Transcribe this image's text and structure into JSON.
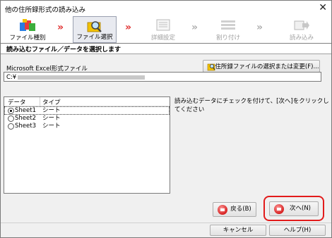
{
  "window": {
    "title": "他の住所録形式の読み込み",
    "close_glyph": "✕"
  },
  "steps": [
    {
      "label": "ファイル種別",
      "state": "done"
    },
    {
      "label": "ファイル選択",
      "state": "active"
    },
    {
      "label": "詳細設定",
      "state": "disabled"
    },
    {
      "label": "割り付け",
      "state": "disabled"
    },
    {
      "label": "読み込み",
      "state": "disabled"
    }
  ],
  "arrows": "»",
  "section_title": "読み込むファイル／データを選択します",
  "file": {
    "type_label": "Microsoft Excel形式ファイル",
    "path_prefix": "C:¥",
    "select_button": "住所録ファイルの選択または変更(F)..."
  },
  "list": {
    "headers": [
      "データ",
      "タイプ"
    ],
    "rows": [
      {
        "name": "Sheet1",
        "type": "シート",
        "selected": true
      },
      {
        "name": "Sheet2",
        "type": "シート",
        "selected": false
      },
      {
        "name": "Sheet3",
        "type": "シート",
        "selected": false
      }
    ]
  },
  "instruction": "読み込むデータにチェックを付けて、[次へ]をクリックしてください",
  "buttons": {
    "back": "戻る(B)",
    "next": "次へ(N)",
    "cancel": "キャンセル",
    "help": "ヘルプ(H)"
  },
  "colors": {
    "accent_red": "#e21b1b",
    "arrow_red": "#e03030"
  }
}
